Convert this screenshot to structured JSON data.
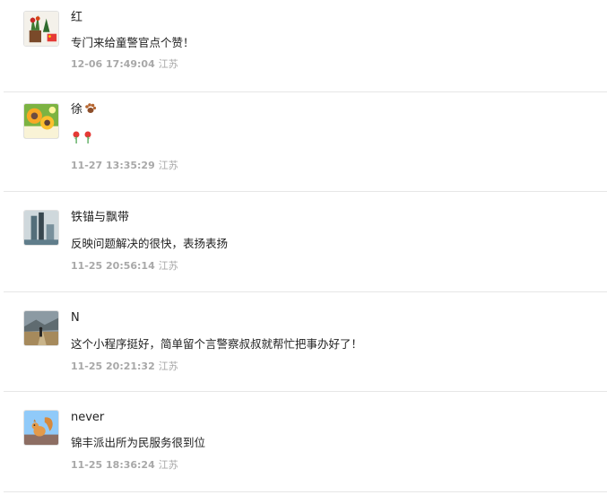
{
  "comments": [
    {
      "name": "红",
      "text": "专门来给童警官点个赞！",
      "time": "12-06 17:49:04",
      "location": "江苏",
      "avatar": "flowers-and-flag-avatar"
    },
    {
      "name": "徐",
      "name_emoji": "paw-emoji",
      "text": "",
      "text_emoji": "rose-emoji",
      "time": "11-27 13:35:29",
      "location": "江苏",
      "avatar": "sunflowers-avatar"
    },
    {
      "name": "铁锚与飘带",
      "text": "反映问题解决的很快，表扬表扬",
      "time": "11-25 20:56:14",
      "location": "江苏",
      "avatar": "city-buildings-avatar"
    },
    {
      "name": "N",
      "text": "这个小程序挺好，简单留个言警察叔叔就帮忙把事办好了！",
      "time": "11-25 20:21:32",
      "location": "江苏",
      "avatar": "person-walking-road-avatar"
    },
    {
      "name": "never",
      "text": "锦丰派出所为民服务很到位",
      "time": "11-25 18:36:24",
      "location": "江苏",
      "avatar": "squirrel-avatar"
    }
  ]
}
